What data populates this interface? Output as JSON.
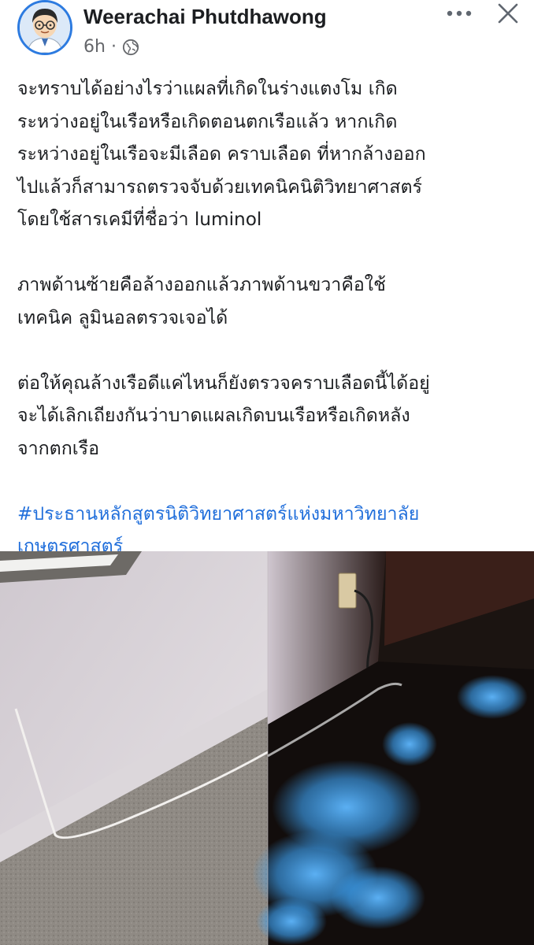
{
  "post": {
    "author": "Weerachai Phutdhawong",
    "time": "6h",
    "separator": "·",
    "text_paragraphs": [
      [
        "จะทราบได้อย่างไรว่าแผลที่เกิดในร่างแตงโม เกิด",
        "ระหว่างอยู่ในเรือหรือเกิดตอนตกเรือแล้ว หากเกิด",
        "ระหว่างอยู่ในเรือจะมีเลือด คราบเลือด ที่หากล้างออก",
        "ไปแล้วก็สามารถตรวจจับด้วยเทคนิคนิติวิทยาศาสตร์",
        "โดยใช้สารเคมีที่ชื่อว่า luminol"
      ],
      [
        "ภาพด้านซ้ายคือล้างออกแล้วภาพด้านขวาคือใช้",
        "เทคนิค ลูมินอลตรวจเจอได้"
      ],
      [
        "ต่อให้คุณล้างเรือดีแค่ไหนก็ยังตรวจคราบเลือดนี้ได้อยู่",
        "จะได้เลิกเถียงกันว่าบาดแผลเกิดบนเรือหรือเกิดหลัง",
        "จากตกเรือ"
      ]
    ],
    "hashtag_lines": [
      "#ประธานหลักสูตรนิติวิทยาศาสตร์แห่งมหาวิทยาลัย",
      "เกษตรศาสตร์"
    ]
  },
  "icons": {
    "more": "more-horizontal-icon",
    "close": "close-icon",
    "audience": "globe-icon"
  },
  "colors": {
    "hashtag": "#216fdb",
    "avatar_ring": "#2d7be0",
    "meta_gray": "#65676b",
    "luminol_glow": "#3fa9ff"
  }
}
